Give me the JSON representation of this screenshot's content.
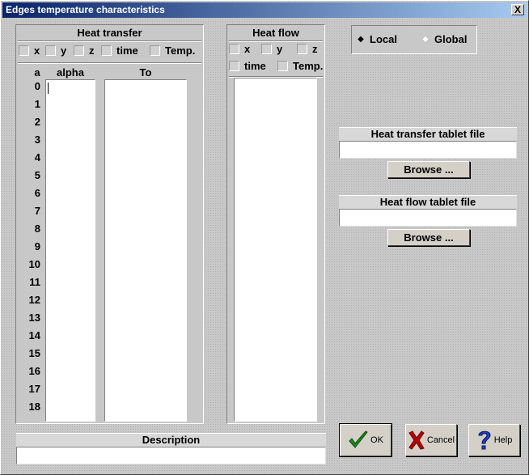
{
  "window": {
    "title": "Edges temperature characteristics",
    "close_glyph": "X"
  },
  "heat_transfer": {
    "title": "Heat transfer",
    "checkboxes": [
      "x",
      "y",
      "z",
      "time",
      "Temp."
    ],
    "columns": {
      "index": "a",
      "alpha": "alpha",
      "to": "To"
    },
    "rows": [
      "0",
      "1",
      "2",
      "3",
      "4",
      "5",
      "6",
      "7",
      "8",
      "9",
      "10",
      "11",
      "12",
      "13",
      "14",
      "15",
      "16",
      "17",
      "18"
    ]
  },
  "heat_flow": {
    "title": "Heat flow",
    "checkboxes": [
      "x",
      "y",
      "z",
      "time",
      "Temp."
    ]
  },
  "coord_mode": {
    "local": "Local",
    "global": "Global",
    "selected": "Local"
  },
  "heat_transfer_file": {
    "label": "Heat transfer tablet file",
    "value": "",
    "browse": "Browse ..."
  },
  "heat_flow_file": {
    "label": "Heat flow tablet file",
    "value": "",
    "browse": "Browse ..."
  },
  "description": {
    "label": "Description",
    "value": ""
  },
  "buttons": {
    "ok": "OK",
    "cancel": "Cancel",
    "help": "Help"
  },
  "icons": {
    "ok": "check-icon",
    "cancel": "cross-icon",
    "help": "question-icon"
  },
  "colors": {
    "title_start": "#0a246a",
    "title_end": "#a6caf0",
    "ok_green": "#1a8a1a",
    "cancel_red": "#c00000",
    "help_blue": "#1f3fbf"
  }
}
